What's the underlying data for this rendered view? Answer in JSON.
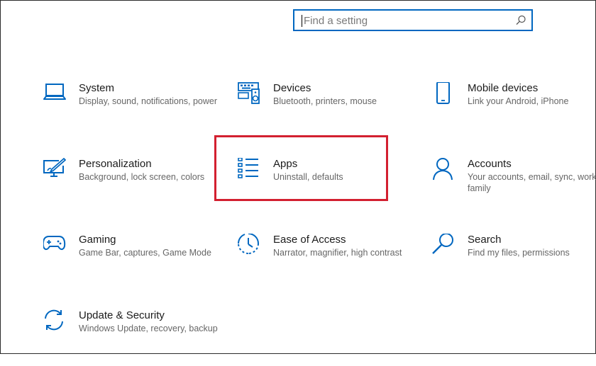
{
  "search": {
    "placeholder": "Find a setting",
    "icon": "search-icon"
  },
  "tiles": [
    {
      "key": "system",
      "title": "System",
      "description": "Display, sound, notifications, power",
      "icon": "laptop-icon"
    },
    {
      "key": "devices",
      "title": "Devices",
      "description": "Bluetooth, printers, mouse",
      "icon": "keyboard-speaker-icon"
    },
    {
      "key": "mobile",
      "title": "Mobile devices",
      "description": "Link your Android, iPhone",
      "icon": "phone-icon"
    },
    {
      "key": "personalization",
      "title": "Personalization",
      "description": "Background, lock screen, colors",
      "icon": "paint-monitor-icon"
    },
    {
      "key": "apps",
      "title": "Apps",
      "description": "Uninstall, defaults",
      "icon": "apps-list-icon"
    },
    {
      "key": "accounts",
      "title": "Accounts",
      "description": "Your accounts, email, sync, work, family",
      "icon": "person-icon"
    },
    {
      "key": "gaming",
      "title": "Gaming",
      "description": "Game Bar, captures, Game Mode",
      "icon": "gamepad-icon"
    },
    {
      "key": "ease",
      "title": "Ease of Access",
      "description": "Narrator, magnifier, high contrast",
      "icon": "ease-of-access-icon"
    },
    {
      "key": "search",
      "title": "Search",
      "description": "Find my files, permissions",
      "icon": "magnifier-icon"
    },
    {
      "key": "update",
      "title": "Update & Security",
      "description": "Windows Update, recovery, backup",
      "icon": "sync-arrows-icon"
    }
  ],
  "colors": {
    "accent": "#0067c0",
    "highlight": "#d32030",
    "title_text": "#1b1b1b",
    "desc_text": "#666666"
  }
}
